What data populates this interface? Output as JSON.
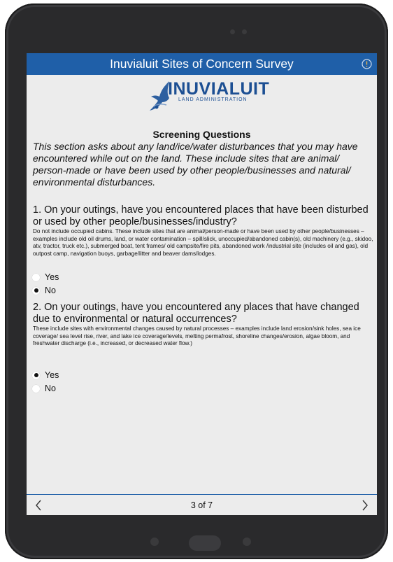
{
  "app": {
    "title": "Inuvialuit Sites of Concern Survey"
  },
  "logo": {
    "name": "INUVIALUIT",
    "subtitle": "LAND ADMINISTRATION"
  },
  "section": {
    "title": "Screening Questions",
    "intro": "This section asks about any land/ice/water disturbances that you may have encountered while out on the land. These include sites that are animal/ person-made or have been used by other people/businesses and natural/ environmental disturbances."
  },
  "questions": [
    {
      "text": "1. On your outings, have you encountered places that have been disturbed or used by other people/businesses/industry?",
      "help": "Do not include occupied cabins. These include sites that are animal/person-made or have been used by other people/businesses – examples include old oil drums, land, or water contamination – spill/slick, unoccupied/abandoned cabin(s), old machinery (e.g., skidoo, atv, tractor, truck etc.), submerged boat, tent frames/ old campsite/fire pits, abandoned work /industrial site (includes oil and gas), old outpost camp, navigation buoys, garbage/litter and beaver dams/lodges.",
      "options": [
        "Yes",
        "No"
      ],
      "selected": "No"
    },
    {
      "text": "2. On your outings, have you encountered any places that have changed due to environmental or natural occurrences?",
      "help": "These include sites with environmental changes caused by natural processes – examples include land erosion/sink holes, sea ice coverage/ sea level rise, river, and lake ice coverage/levels, melting permafrost, shoreline changes/erosion, algae bloom, and freshwater discharge (i.e., increased, or decreased water flow.)",
      "options": [
        "Yes",
        "No"
      ],
      "selected": "Yes"
    }
  ],
  "footer": {
    "page_indicator": "3 of 7",
    "prev_icon": "chevron-left",
    "next_icon": "chevron-right"
  },
  "colors": {
    "accent": "#1f5fa8",
    "screen_bg": "#ececec",
    "device": "#2a2a2c"
  }
}
